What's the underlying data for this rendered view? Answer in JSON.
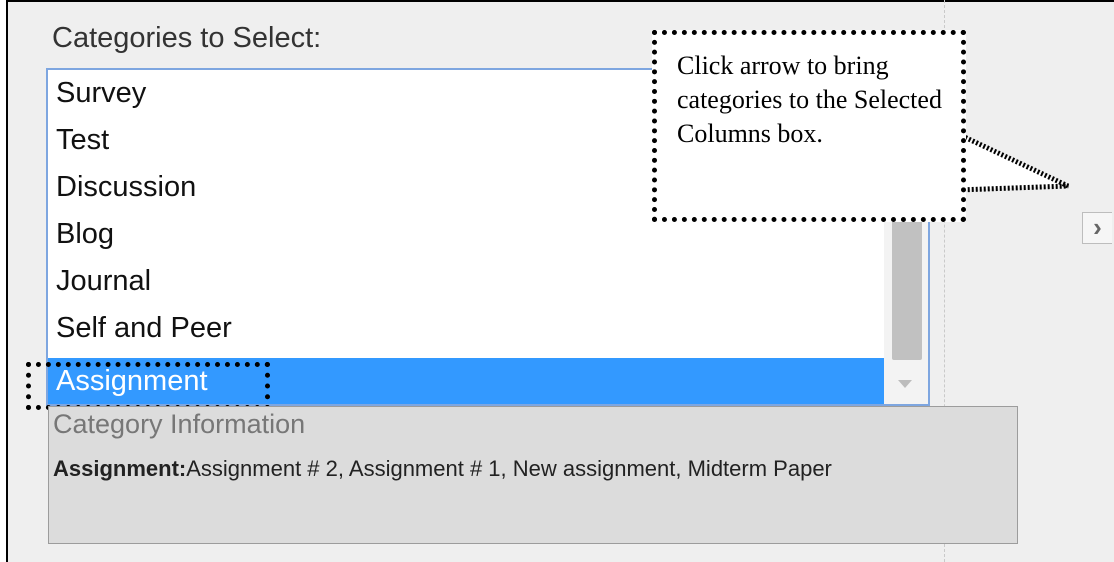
{
  "section_label": "Categories to Select:",
  "categories": [
    {
      "label": "Survey",
      "selected": false
    },
    {
      "label": "Test",
      "selected": false
    },
    {
      "label": "Discussion",
      "selected": false
    },
    {
      "label": "Blog",
      "selected": false
    },
    {
      "label": "Journal",
      "selected": false
    },
    {
      "label": "Self and Peer",
      "selected": false
    },
    {
      "label": "Assignment",
      "selected": true
    }
  ],
  "info": {
    "title": "Category Information",
    "category_name": "Assignment:",
    "category_items": "Assignment # 2, Assignment # 1, New assignment, Midterm Paper"
  },
  "callout": {
    "text": "Click arrow to bring categories to the Selected Columns box."
  },
  "move_button": {
    "glyph": "›",
    "icon": "chevron-right-icon"
  },
  "colors": {
    "selection": "#3399ff",
    "listbox_border": "#7ea6e0",
    "panel_background": "#dcdcdc"
  }
}
